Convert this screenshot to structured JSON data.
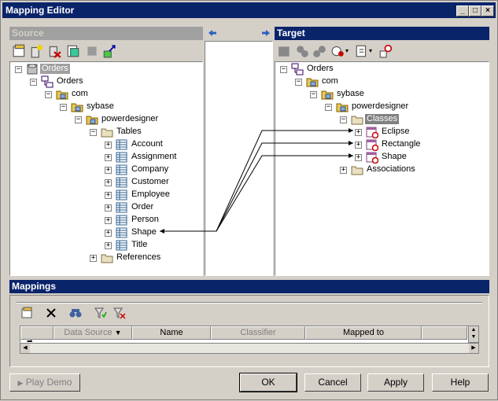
{
  "window": {
    "title": "Mapping Editor"
  },
  "source": {
    "header": "Source",
    "tree": [
      {
        "label": "Orders",
        "icon": "database-icon",
        "depth": 0,
        "selected": true
      },
      {
        "label": "Orders",
        "icon": "model-icon",
        "depth": 1
      },
      {
        "label": "com",
        "icon": "package-icon",
        "depth": 2
      },
      {
        "label": "sybase",
        "icon": "package-icon",
        "depth": 3
      },
      {
        "label": "powerdesigner",
        "icon": "package-icon",
        "depth": 4
      },
      {
        "label": "Tables",
        "icon": "folder-icon",
        "depth": 5
      },
      {
        "label": "Account",
        "icon": "table-icon",
        "depth": 6
      },
      {
        "label": "Assignment",
        "icon": "table-icon",
        "depth": 6
      },
      {
        "label": "Company",
        "icon": "table-icon",
        "depth": 6
      },
      {
        "label": "Customer",
        "icon": "table-icon",
        "depth": 6
      },
      {
        "label": "Employee",
        "icon": "table-icon",
        "depth": 6
      },
      {
        "label": "Order",
        "icon": "table-icon",
        "depth": 6
      },
      {
        "label": "Person",
        "icon": "table-icon",
        "depth": 6
      },
      {
        "label": "Shape",
        "icon": "table-icon",
        "depth": 6
      },
      {
        "label": "Title",
        "icon": "table-icon",
        "depth": 6
      },
      {
        "label": "References",
        "icon": "folder-icon",
        "depth": 5
      }
    ]
  },
  "target": {
    "header": "Target",
    "tree": [
      {
        "label": "Orders",
        "icon": "model-icon",
        "depth": 0
      },
      {
        "label": "com",
        "icon": "package-icon",
        "depth": 1
      },
      {
        "label": "sybase",
        "icon": "package-icon",
        "depth": 2
      },
      {
        "label": "powerdesigner",
        "icon": "package-icon",
        "depth": 3
      },
      {
        "label": "Classes",
        "icon": "folder-icon",
        "depth": 4,
        "selected": true
      },
      {
        "label": "Eclipse",
        "icon": "class-icon",
        "depth": 5
      },
      {
        "label": "Rectangle",
        "icon": "class-icon",
        "depth": 5
      },
      {
        "label": "Shape",
        "icon": "class-icon",
        "depth": 5
      },
      {
        "label": "Associations",
        "icon": "folder-icon",
        "depth": 4
      }
    ]
  },
  "mappings": {
    "header": "Mappings",
    "columns": [
      "Data Source",
      "Name",
      "Classifier",
      "Mapped to"
    ]
  },
  "buttons": {
    "play_demo": "Play Demo",
    "ok": "OK",
    "cancel": "Cancel",
    "apply": "Apply",
    "help": "Help"
  },
  "colors": {
    "title_bar": "#0a246a",
    "face": "#d4d0c8",
    "inactive_header": "#a0a0a0"
  }
}
